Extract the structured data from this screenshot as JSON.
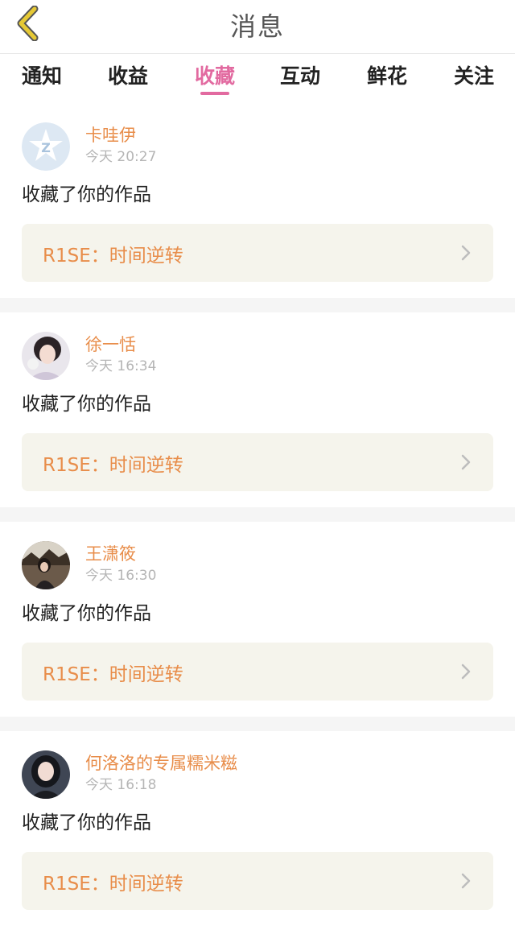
{
  "header": {
    "title": "消息"
  },
  "tabs": [
    {
      "label": "通知"
    },
    {
      "label": "收益"
    },
    {
      "label": "收藏"
    },
    {
      "label": "互动"
    },
    {
      "label": "鲜花"
    },
    {
      "label": "关注"
    }
  ],
  "active_tab_index": 2,
  "messages": [
    {
      "username": "卡哇伊",
      "time": "今天 20:27",
      "action": "收藏了你的作品",
      "work_title": "R1SE：时间逆转",
      "avatar_icon": "default-avatar-icon"
    },
    {
      "username": "徐一恬",
      "time": "今天 16:34",
      "action": "收藏了你的作品",
      "work_title": "R1SE：时间逆转",
      "avatar_icon": "user-photo"
    },
    {
      "username": "王潇筱",
      "time": "今天 16:30",
      "action": "收藏了你的作品",
      "work_title": "R1SE：时间逆转",
      "avatar_icon": "user-photo"
    },
    {
      "username": "何洛洛的专属糯米糍",
      "time": "今天 16:18",
      "action": "收藏了你的作品",
      "work_title": "R1SE：时间逆转",
      "avatar_icon": "user-photo"
    }
  ],
  "colors": {
    "accent": "#e26aa0",
    "username": "#e88d4a",
    "work_bg": "#f5f4ec",
    "back_arrow": "#e6c935"
  }
}
